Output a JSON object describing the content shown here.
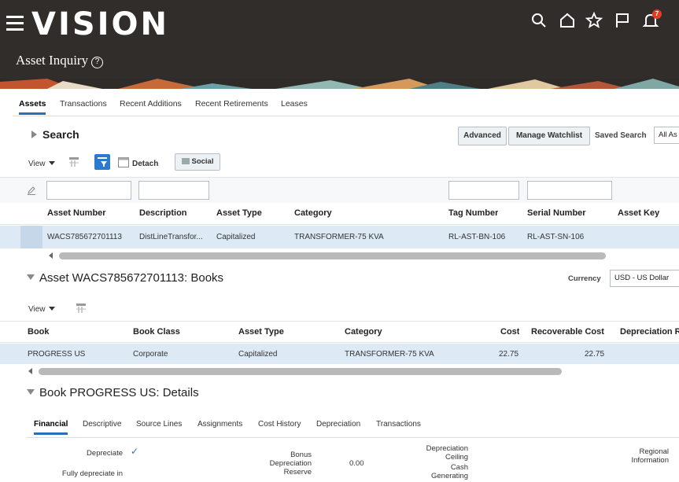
{
  "app": {
    "logo": "VISION",
    "page_title": "Asset Inquiry",
    "help_glyph": "?",
    "notification_count": "7",
    "icons": [
      "hamburger-icon",
      "search-icon",
      "home-icon",
      "star-icon",
      "flag-icon",
      "bell-icon"
    ]
  },
  "tabs": [
    {
      "label": "Assets",
      "active": true
    },
    {
      "label": "Transactions",
      "active": false
    },
    {
      "label": "Recent Additions",
      "active": false
    },
    {
      "label": "Recent Retirements",
      "active": false
    },
    {
      "label": "Leases",
      "active": false
    }
  ],
  "search": {
    "title": "Search",
    "advanced_label": "Advanced",
    "manage_watchlist_label": "Manage Watchlist",
    "saved_search_label": "Saved Search",
    "saved_search_value": "All As"
  },
  "toolbar": {
    "view_label": "View",
    "detach_label": "Detach",
    "social_label": "Social"
  },
  "assets_table": {
    "columns": [
      "Asset Number",
      "Description",
      "Asset Type",
      "Category",
      "Tag Number",
      "Serial Number",
      "Asset Key"
    ],
    "rows": [
      [
        "WACS785672701113",
        "DistLineTransfor...",
        "Capitalized",
        "TRANSFORMER-75 KVA",
        "RL-AST-BN-106",
        "RL-AST-SN-106",
        ""
      ]
    ]
  },
  "books": {
    "title": "Asset WACS785672701113: Books",
    "currency_label": "Currency",
    "currency_value": "USD - US Dollar",
    "view_label": "View",
    "columns": [
      "Book",
      "Book Class",
      "Asset Type",
      "Category",
      "Cost",
      "Recoverable Cost",
      "Depreciation R"
    ],
    "rows": [
      [
        "PROGRESS US",
        "Corporate",
        "Capitalized",
        "TRANSFORMER-75 KVA",
        "22.75",
        "22.75",
        ""
      ]
    ]
  },
  "details": {
    "title": "Book PROGRESS US: Details",
    "tabs": [
      {
        "label": "Financial",
        "active": true
      },
      {
        "label": "Descriptive",
        "active": false
      },
      {
        "label": "Source Lines",
        "active": false
      },
      {
        "label": "Assignments",
        "active": false
      },
      {
        "label": "Cost History",
        "active": false
      },
      {
        "label": "Depreciation",
        "active": false
      },
      {
        "label": "Transactions",
        "active": false
      }
    ],
    "fields": {
      "depreciate_label": "Depreciate",
      "depreciate_value": "✓",
      "fully_depreciate_label": "Fully depreciate in",
      "bonus_label_1": "Bonus",
      "bonus_label_2": "Depreciation",
      "bonus_label_3": "Reserve",
      "bonus_value": "0.00",
      "ceiling_label_1": "Depreciation",
      "ceiling_label_2": "Ceiling",
      "cash_label_1": "Cash",
      "cash_label_2": "Generating",
      "regional_label_1": "Regional",
      "regional_label_2": "Information"
    }
  },
  "colors": {
    "header_bg": "#312d2a",
    "accent": "#2a6fb5",
    "selected_row": "#ddeaf6",
    "badge": "#e63b22"
  }
}
